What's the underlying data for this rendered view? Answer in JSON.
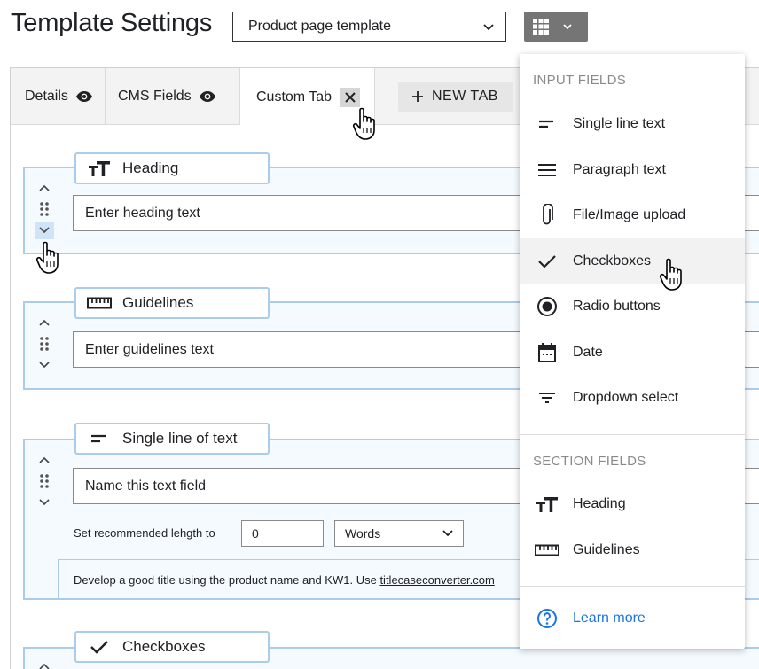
{
  "page": {
    "title": "Template Settings"
  },
  "template_select": {
    "value": "Product page template"
  },
  "tabs": [
    {
      "label": "Details"
    },
    {
      "label": "CMS Fields"
    },
    {
      "label": "Custom Tab"
    }
  ],
  "new_tab": {
    "label": "NEW TAB"
  },
  "fields": {
    "heading": {
      "label": "Heading",
      "placeholder": "Enter heading text"
    },
    "guidelines": {
      "label": "Guidelines",
      "placeholder": "Enter guidelines text"
    },
    "single_line": {
      "label": "Single line of text",
      "placeholder": "Name this text field",
      "recommended_label": "Set recommended lehgth to",
      "recommended_value": "0",
      "unit": "Words",
      "hint": "Develop a good title using the product name and KW1. Use ",
      "hint_link": "titlecaseconverter.com"
    },
    "checkboxes": {
      "label": "Checkboxes"
    }
  },
  "dropdown": {
    "input_section": "INPUT FIELDS",
    "input_items": [
      {
        "label": "Single line text",
        "icon": "short-text-icon"
      },
      {
        "label": "Paragraph text",
        "icon": "paragraph-icon"
      },
      {
        "label": "File/Image upload",
        "icon": "paperclip-icon"
      },
      {
        "label": "Checkboxes",
        "icon": "check-icon"
      },
      {
        "label": "Radio buttons",
        "icon": "radio-icon"
      },
      {
        "label": "Date",
        "icon": "calendar-icon"
      },
      {
        "label": "Dropdown select",
        "icon": "filter-lines-icon"
      }
    ],
    "section_title": "SECTION FIELDS",
    "section_items": [
      {
        "label": "Heading",
        "icon": "text-size-icon"
      },
      {
        "label": "Guidelines",
        "icon": "ruler-icon"
      }
    ],
    "learn_more": "Learn more"
  },
  "colors": {
    "accent_border": "#a9cdea",
    "field_bg": "#f5fafe",
    "link": "#1a73e8"
  }
}
